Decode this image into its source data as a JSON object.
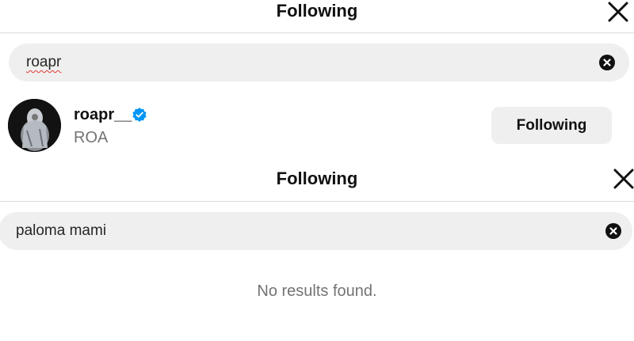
{
  "top_panel": {
    "title": "Following",
    "search_value": "roapr",
    "result": {
      "username": "roapr__",
      "full_name": "ROA",
      "verified": true,
      "button_label": "Following"
    }
  },
  "bottom_panel": {
    "title": "Following",
    "search_value": "paloma mami",
    "empty_message": "No results found."
  },
  "colors": {
    "verified_blue": "#0095f6",
    "search_bg": "#efefef",
    "muted_text": "#737373"
  }
}
